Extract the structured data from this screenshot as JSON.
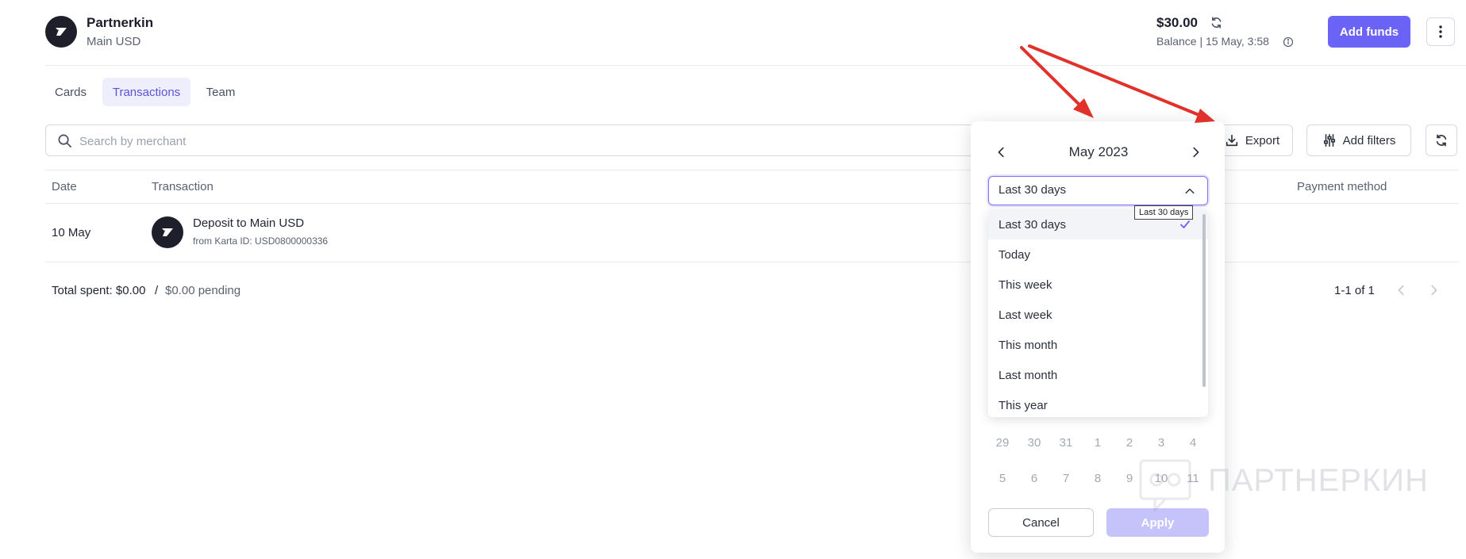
{
  "header": {
    "company": "Partnerkin",
    "account": "Main USD",
    "balance_amount": "$30.00",
    "balance_sub": "Balance | 15 May, 3:58",
    "add_funds_label": "Add funds"
  },
  "tabs": [
    {
      "label": "Cards"
    },
    {
      "label": "Transactions",
      "active": true
    },
    {
      "label": "Team"
    }
  ],
  "search": {
    "placeholder": "Search by merchant"
  },
  "toolbar": {
    "export_label": "Export",
    "filters_label": "Add filters"
  },
  "table": {
    "columns": [
      "Date",
      "Transaction",
      "Payment method"
    ],
    "rows": [
      {
        "date": "10 May",
        "title": "Deposit to Main USD",
        "subtitle": "from Karta ID: USD0800000336"
      }
    ]
  },
  "footer": {
    "total_label": "Total spent: $0.00",
    "separator": "/",
    "pending": "$0.00 pending",
    "pager": "1-1 of 1"
  },
  "date_picker": {
    "month": "May 2023",
    "range_value": "Last 30 days",
    "tooltip": "Last 30 days",
    "options": [
      "Last 30 days",
      "Today",
      "This week",
      "Last week",
      "This month",
      "Last month",
      "This year"
    ],
    "selected_option": "Last 30 days",
    "visible_weeks": [
      [
        "29",
        "30",
        "31",
        "1",
        "2",
        "3",
        "4"
      ],
      [
        "5",
        "6",
        "7",
        "8",
        "9",
        "10",
        "11"
      ]
    ],
    "cancel_label": "Cancel",
    "apply_label": "Apply"
  },
  "watermark": {
    "text": "ПАРТНЕРКИН"
  },
  "colors": {
    "accent": "#6b63f6",
    "accent_light": "#eeeefd",
    "apply_disabled": "#c6c3fb",
    "annotation_arrow": "#e0322a",
    "dark": "#1e1f2b"
  },
  "icons": [
    "brand-logo-icon",
    "refresh-icon",
    "info-icon",
    "more-vertical-icon",
    "search-icon",
    "download-icon",
    "sliders-icon",
    "chevron-left-icon",
    "chevron-right-icon",
    "chevron-up-icon",
    "check-icon"
  ]
}
